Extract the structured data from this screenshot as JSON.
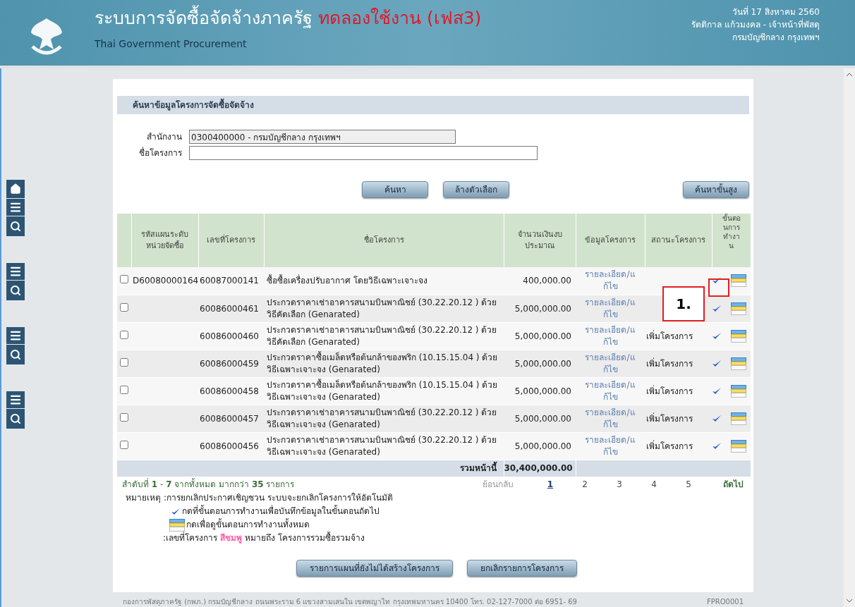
{
  "header": {
    "title": "ระบบการจัดซื้อจัดจ้างภาครัฐ",
    "title_highlight": "ทดลองใช้งาน (เฟส3)",
    "subtitle": "Thai Government Procurement",
    "date": "วันที่ 17 สิงหาคม 2560",
    "user": "รัตติกาล แก้วมงคล - เจ้าหน้าที่พัสดุ",
    "office": "กรมบัญชีกลาง กรุงเทพฯ"
  },
  "sidebar": {
    "groups": [
      {
        "items": [
          {
            "kind": "home"
          },
          {
            "kind": "menu"
          },
          {
            "kind": "search"
          }
        ]
      },
      {
        "items": [
          {
            "kind": "menu"
          },
          {
            "kind": "search"
          }
        ]
      },
      {
        "items": [
          {
            "kind": "menu"
          },
          {
            "kind": "search"
          }
        ]
      },
      {
        "items": [
          {
            "kind": "menu"
          },
          {
            "kind": "search"
          }
        ]
      }
    ]
  },
  "panel_title": "ค้นหาข้อมูลโครงการจัดซื้อจัดจ้าง",
  "form": {
    "fields": [
      {
        "label": "สำนักงาน",
        "value": "0300400000 - กรมบัญชีกลาง กรุงเทพฯ",
        "disabled": true
      },
      {
        "label": "ชื่อโครงการ",
        "disabled": false
      }
    ]
  },
  "buttons": {
    "search": "ค้นหา",
    "clear": "ล้างตัวเลือก",
    "advanced": "ค้นหาขั้นสูง"
  },
  "table": {
    "columns": [
      "รหัสแผนระดับหน่วยจัดซื้อ",
      "เลขที่โครงการ",
      "ชื่อโครงการ",
      "จำนวนเงินงบประมาณ",
      "ข้อมูลโครงการ",
      "สถานะโครงการ",
      "ขั้นตอนการทำงาน"
    ],
    "rows": [
      {
        "checked": false,
        "plan_code": "D60080000164",
        "project_no": "60087000141",
        "name": "ซื้อซื้อเครื่องปรับอากาศ โดยวิธีเฉพาะเจาะจง",
        "amount": "400,000.00",
        "link": "รายละเอียด/แก้ไข"
      },
      {
        "checked": false,
        "project_no": "60086000461",
        "name": "ประกวดราคาเช่าอาคารสนามบินพาณิชย์ (30.22.20.12 ) ด้วยวิธีคัดเลือก (Genarated)",
        "amount": "5,000,000.00",
        "link": "รายละเอียด/แก้ไข"
      },
      {
        "checked": false,
        "project_no": "60086000460",
        "name": "ประกวดราคาเช่าอาคารสนามบินพาณิชย์ (30.22.20.12 ) ด้วยวิธีคัดเลือก (Genarated)",
        "amount": "5,000,000.00",
        "link": "รายละเอียด/แก้ไข",
        "status": "เพิ่มโครงการ"
      },
      {
        "checked": false,
        "project_no": "60086000459",
        "name": "ประกวดราคาซื้อเมล็ดหรือต้นกล้าของพริก (10.15.15.04 ) ด้วยวิธีเฉพาะเจาะจง (Genarated)",
        "amount": "5,000,000.00",
        "link": "รายละเอียด/แก้ไข",
        "status": "เพิ่มโครงการ"
      },
      {
        "checked": false,
        "project_no": "60086000458",
        "name": "ประกวดราคาซื้อเมล็ดหรือต้นกล้าของพริก (10.15.15.04 ) ด้วยวิธีเฉพาะเจาะจง (Genarated)",
        "amount": "5,000,000.00",
        "link": "รายละเอียด/แก้ไข",
        "status": "เพิ่มโครงการ"
      },
      {
        "checked": false,
        "project_no": "60086000457",
        "name": "ประกวดราคาเช่าอาคารสนามบินพาณิชย์ (30.22.20.12 ) ด้วยวิธีเฉพาะเจาะจง (Genarated)",
        "amount": "5,000,000.00",
        "link": "รายละเอียด/แก้ไข",
        "status": "เพิ่มโครงการ"
      },
      {
        "checked": false,
        "project_no": "60086000456",
        "name": "ประกวดราคาเช่าอาคารสนามบินพาณิชย์ (30.22.20.12 ) ด้วยวิธีเฉพาะเจาะจง (Genarated)",
        "amount": "5,000,000.00",
        "link": "รายละเอียด/แก้ไข",
        "status": "เพิ่มโครงการ"
      }
    ],
    "total_label": "รวมหน้านี้",
    "total": "30,400,000.00"
  },
  "callout": "1.",
  "summary": "สำดับที่ **1** - **7** จากทั้งหมด มากกว่า **35** รายการ",
  "pagination": {
    "prev": {
      "label": "ย้อนกลับ",
      "disabled": true
    },
    "pages": [
      {
        "label": "1",
        "selected": true
      },
      {
        "label": "2",
        "selected": false
      },
      {
        "label": "3",
        "selected": false
      },
      {
        "label": "4",
        "selected": false
      },
      {
        "label": "5",
        "selected": false
      }
    ],
    "next": {
      "label": "ถัดไป",
      "disabled": false
    }
  },
  "notes": {
    "label": "หมายเหตุ :",
    "lines": [
      {
        "kind": "text",
        "text": "การยกเลิกประกาศเชิญชวน ระบบจะยกเลิกโครงการให้อัตโนมัติ"
      },
      {
        "kind": "check",
        "text": "กดที่ขั้นตอนการทำงานเพื่อบันทึกข้อมูลในขั้นตอนถัดไป"
      },
      {
        "kind": "steps",
        "text": "กดเพื่อดูขั้นตอนการทำงานทั้งหมด"
      },
      {
        "kind": "color",
        "text": ":เลขที่โครงการ",
        "color_word": "สีชมพู",
        "color": "#ff5ca8",
        "tail": "หมายถึง โครงการรวมซื้อรวมจ้าง"
      }
    ]
  },
  "bottom_buttons": [
    "รายการแผนที่ยังไม่ได้สร้างโครงการ",
    "ยกเลิกรายการโครงการ"
  ],
  "footer": {
    "address": "กองการพัสดุภาครัฐ (กพภ.) กรมบัญชีกลาง ถนนพระราม 6 แขวงสามเสนใน เขตพญาไท กรุงเทพมหานคร 10400 โทร. 02-127-7000 ต่อ 6951- 69",
    "code": "FPRO0001"
  }
}
